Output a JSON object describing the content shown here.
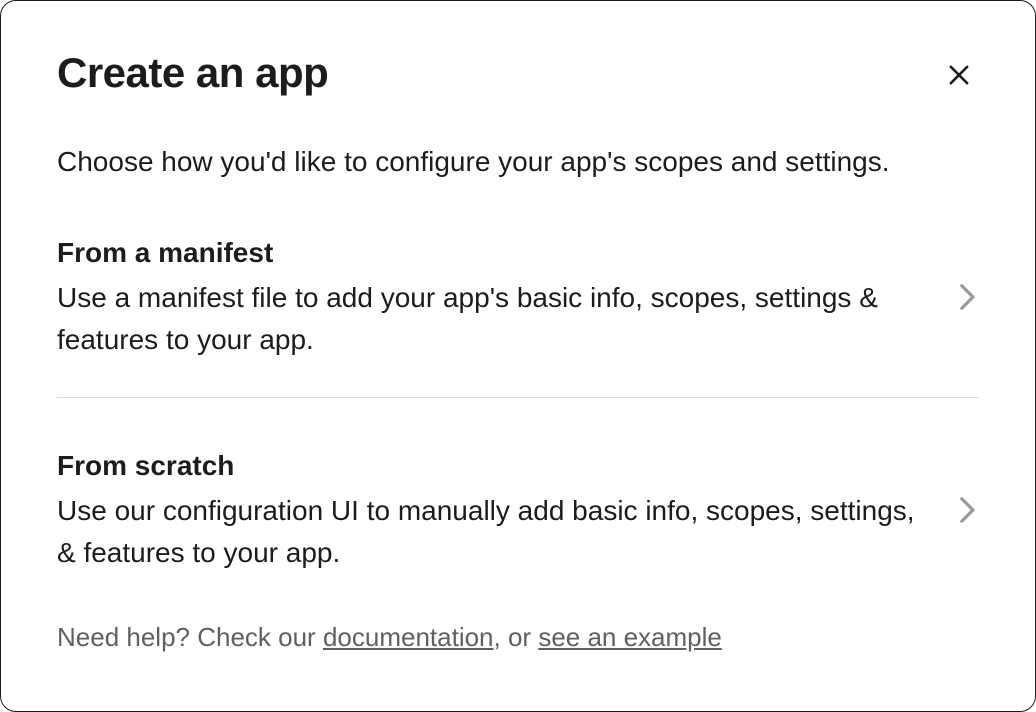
{
  "modal": {
    "title": "Create an app",
    "subtitle": "Choose how you'd like to configure your app's scopes and settings."
  },
  "options": [
    {
      "title": "From a manifest",
      "description": "Use a manifest file to add your app's basic info, scopes, settings & features to your app."
    },
    {
      "title": "From scratch",
      "description": "Use our configuration UI to manually add basic info, scopes, settings, & features to your app."
    }
  ],
  "help": {
    "prefix": "Need help? Check our ",
    "doc_link": "documentation",
    "middle": ", or ",
    "example_link": "see an example"
  }
}
